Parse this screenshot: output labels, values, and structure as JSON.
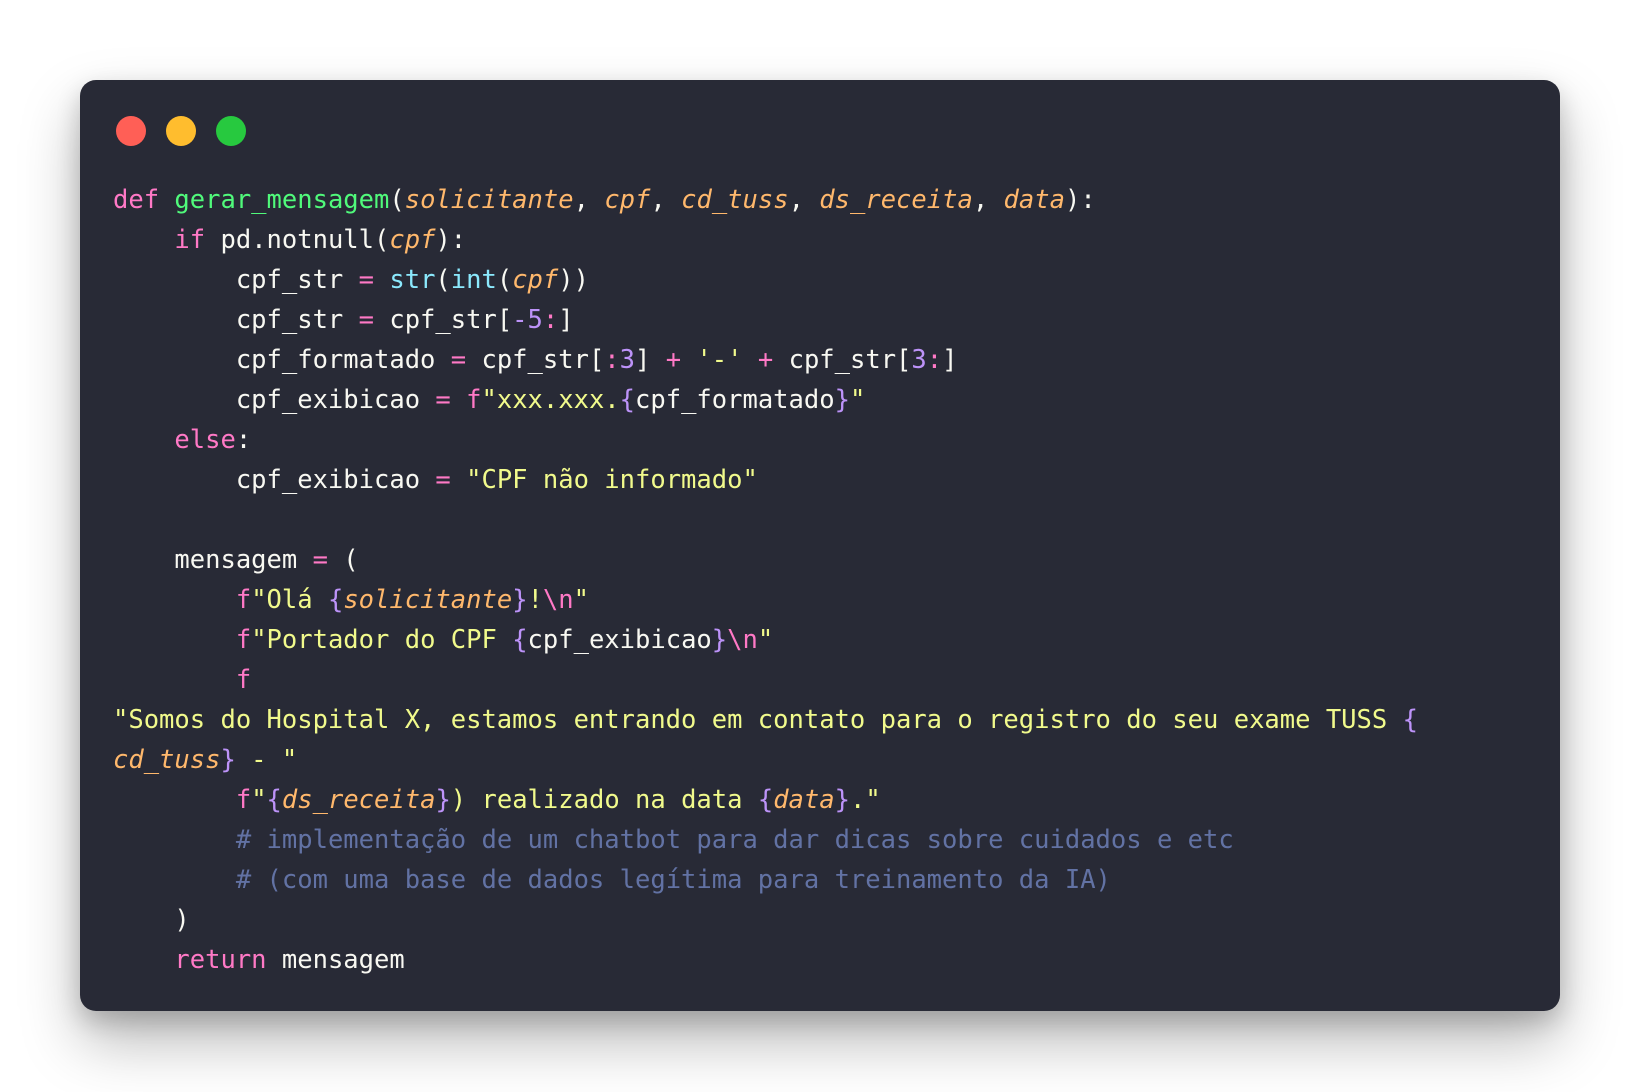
{
  "colors": {
    "background": "#282a36",
    "page": "#ffffff",
    "red_light": "#ff5f56",
    "yellow_light": "#ffbd2e",
    "green_light": "#27c93f"
  },
  "window_controls": [
    "close",
    "minimize",
    "maximize"
  ],
  "code": {
    "language": "python",
    "lines": [
      [
        [
          "kw",
          "def"
        ],
        [
          "plain",
          " "
        ],
        [
          "fn",
          "gerar_mensagem"
        ],
        [
          "plain",
          "("
        ],
        [
          "param",
          "solicitante"
        ],
        [
          "plain",
          ", "
        ],
        [
          "param",
          "cpf"
        ],
        [
          "plain",
          ", "
        ],
        [
          "param",
          "cd_tuss"
        ],
        [
          "plain",
          ", "
        ],
        [
          "param",
          "ds_receita"
        ],
        [
          "plain",
          ", "
        ],
        [
          "param",
          "data"
        ],
        [
          "plain",
          "):"
        ]
      ],
      [
        [
          "plain",
          "    "
        ],
        [
          "kw",
          "if"
        ],
        [
          "plain",
          " pd.notnull("
        ],
        [
          "param",
          "cpf"
        ],
        [
          "plain",
          "):"
        ]
      ],
      [
        [
          "plain",
          "        cpf_str "
        ],
        [
          "op",
          "="
        ],
        [
          "plain",
          " "
        ],
        [
          "builtin",
          "str"
        ],
        [
          "plain",
          "("
        ],
        [
          "builtin",
          "int"
        ],
        [
          "plain",
          "("
        ],
        [
          "param",
          "cpf"
        ],
        [
          "plain",
          "))"
        ]
      ],
      [
        [
          "plain",
          "        cpf_str "
        ],
        [
          "op",
          "="
        ],
        [
          "plain",
          " cpf_str["
        ],
        [
          "num",
          "-5"
        ],
        [
          "op",
          ":"
        ],
        [
          "plain",
          "]"
        ]
      ],
      [
        [
          "plain",
          "        cpf_formatado "
        ],
        [
          "op",
          "="
        ],
        [
          "plain",
          " cpf_str["
        ],
        [
          "op",
          ":"
        ],
        [
          "num",
          "3"
        ],
        [
          "plain",
          "] "
        ],
        [
          "op",
          "+"
        ],
        [
          "plain",
          " "
        ],
        [
          "str",
          "'-'"
        ],
        [
          "plain",
          " "
        ],
        [
          "op",
          "+"
        ],
        [
          "plain",
          " cpf_str["
        ],
        [
          "num",
          "3"
        ],
        [
          "op",
          ":"
        ],
        [
          "plain",
          "]"
        ]
      ],
      [
        [
          "plain",
          "        cpf_exibicao "
        ],
        [
          "op",
          "="
        ],
        [
          "plain",
          " "
        ],
        [
          "kw",
          "f"
        ],
        [
          "str",
          "\"xxx.xxx."
        ],
        [
          "brace",
          "{"
        ],
        [
          "plain",
          "cpf_formatado"
        ],
        [
          "brace",
          "}"
        ],
        [
          "str",
          "\""
        ]
      ],
      [
        [
          "plain",
          "    "
        ],
        [
          "kw",
          "else"
        ],
        [
          "plain",
          ":"
        ]
      ],
      [
        [
          "plain",
          "        cpf_exibicao "
        ],
        [
          "op",
          "="
        ],
        [
          "plain",
          " "
        ],
        [
          "str",
          "\"CPF não informado\""
        ]
      ],
      [
        [
          "plain",
          ""
        ]
      ],
      [
        [
          "plain",
          "    mensagem "
        ],
        [
          "op",
          "="
        ],
        [
          "plain",
          " ("
        ]
      ],
      [
        [
          "plain",
          "        "
        ],
        [
          "kw",
          "f"
        ],
        [
          "str",
          "\"Olá "
        ],
        [
          "brace",
          "{"
        ],
        [
          "param",
          "solicitante"
        ],
        [
          "brace",
          "}"
        ],
        [
          "str",
          "!"
        ],
        [
          "esc",
          "\\n"
        ],
        [
          "str",
          "\""
        ]
      ],
      [
        [
          "plain",
          "        "
        ],
        [
          "kw",
          "f"
        ],
        [
          "str",
          "\"Portador do CPF "
        ],
        [
          "brace",
          "{"
        ],
        [
          "plain",
          "cpf_exibicao"
        ],
        [
          "brace",
          "}"
        ],
        [
          "esc",
          "\\n"
        ],
        [
          "str",
          "\""
        ]
      ],
      [
        [
          "plain",
          "        "
        ],
        [
          "kw",
          "f"
        ]
      ],
      [
        [
          "str",
          "\"Somos do Hospital X, estamos entrando em contato para o registro do seu exame TUSS "
        ],
        [
          "brace",
          "{"
        ]
      ],
      [
        [
          "param",
          "cd_tuss"
        ],
        [
          "brace",
          "}"
        ],
        [
          "str",
          " - \""
        ]
      ],
      [
        [
          "plain",
          "        "
        ],
        [
          "kw",
          "f"
        ],
        [
          "str",
          "\""
        ],
        [
          "brace",
          "{"
        ],
        [
          "param",
          "ds_receita"
        ],
        [
          "brace",
          "}"
        ],
        [
          "str",
          ") realizado na data "
        ],
        [
          "brace",
          "{"
        ],
        [
          "param",
          "data"
        ],
        [
          "brace",
          "}"
        ],
        [
          "str",
          ".\""
        ]
      ],
      [
        [
          "plain",
          "        "
        ],
        [
          "comment",
          "# implementação de um chatbot para dar dicas sobre cuidados e etc"
        ]
      ],
      [
        [
          "plain",
          "        "
        ],
        [
          "comment",
          "# (com uma base de dados legítima para treinamento da IA)"
        ]
      ],
      [
        [
          "plain",
          "    )"
        ]
      ],
      [
        [
          "plain",
          "    "
        ],
        [
          "kw",
          "return"
        ],
        [
          "plain",
          " mensagem"
        ]
      ]
    ]
  }
}
